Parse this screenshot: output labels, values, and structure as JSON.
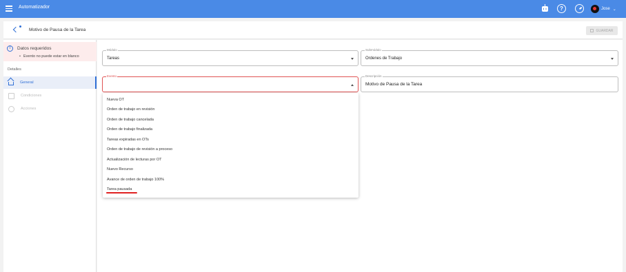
{
  "app": {
    "title": "Automatizador"
  },
  "user": {
    "name": "Jose"
  },
  "header": {
    "title": "Motivo de Pausa de la Tarea",
    "save_label": "GUARDAR"
  },
  "alert": {
    "title": "Datos requeridos",
    "items": [
      "Evento no puede estar en blanco"
    ]
  },
  "sidebar": {
    "section_label": "Detalles",
    "items": [
      {
        "label": "General",
        "icon": "home-icon",
        "active": true
      },
      {
        "label": "Condiciones",
        "icon": "conditions-icon",
        "active": false
      },
      {
        "label": "Acciones",
        "icon": "actions-icon",
        "active": false
      }
    ]
  },
  "form": {
    "modulo": {
      "label": "Módulo",
      "value": "Tareas"
    },
    "submodulo": {
      "label": "Submódulo",
      "value": "Ordenes de Trabajo"
    },
    "evento": {
      "label": "Evento",
      "value": ""
    },
    "descripcion": {
      "label": "Descripción",
      "value": "Motivo de Pausa de la Tarea"
    }
  },
  "dropdown": {
    "options": [
      "Nueva OT",
      "Orden de trabajo en revisión",
      "Orden de trabajo cancelada",
      "Orden de trabajo finalizada",
      "Tareas expiradas en OTs",
      "Orden de trabajo de revisión a proceso",
      "Actualización de lecturas por OT",
      "Nuevo Recurso",
      "Avance de orden de trabajo 100%",
      "Tarea pausada"
    ],
    "highlighted_option": "Tarea pausada",
    "highlight_color": "#e02020"
  },
  "colors": {
    "topbar": "#4a8ae6",
    "accent": "#2f6fd6",
    "error": "#e05252",
    "alert_bg": "#fdecec"
  }
}
